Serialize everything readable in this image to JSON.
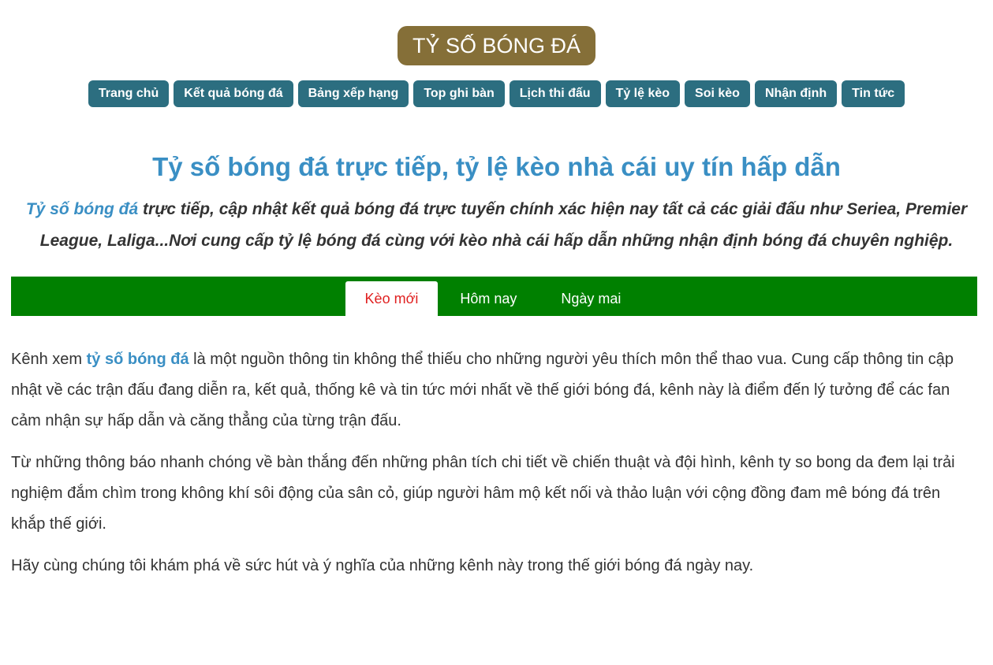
{
  "header": {
    "logo_text": "TỶ SỐ BÓNG ĐÁ"
  },
  "nav": {
    "items": [
      {
        "label": "Trang chủ"
      },
      {
        "label": "Kết quả bóng đá"
      },
      {
        "label": "Bảng xếp hạng"
      },
      {
        "label": "Top ghi bàn"
      },
      {
        "label": "Lịch thi đấu"
      },
      {
        "label": "Tỷ lệ kèo"
      },
      {
        "label": "Soi kèo"
      },
      {
        "label": "Nhận định"
      },
      {
        "label": "Tin tức"
      }
    ]
  },
  "hero": {
    "title": "Tỷ số bóng đá trực tiếp, tỷ lệ kèo nhà cái uy tín hấp dẫn",
    "intro_link": "Tỷ số bóng đá",
    "intro_text": " trực tiếp, cập nhật kết quả bóng đá trực tuyến chính xác hiện nay tất cả các giải đấu như Seriea, Premier League, Laliga...Nơi cung cấp tỷ lệ bóng đá cùng với kèo nhà cái hấp dẫn những nhận định bóng đá chuyên nghiệp."
  },
  "tabs": [
    {
      "label": "Kèo mới",
      "active": true
    },
    {
      "label": "Hôm nay",
      "active": false
    },
    {
      "label": "Ngày mai",
      "active": false
    }
  ],
  "content": {
    "p1_before": "Kênh xem ",
    "p1_link": "tỷ số bóng đá",
    "p1_after": " là một nguồn thông tin không thể thiếu cho những người yêu thích môn thể thao vua. Cung cấp thông tin cập nhật về các trận đấu đang diễn ra, kết quả, thống kê và tin tức mới nhất về thế giới bóng đá, kênh này là điểm đến lý tưởng để các fan cảm nhận sự hấp dẫn và căng thẳng của từng trận đấu.",
    "p2": "Từ những thông báo nhanh chóng về bàn thắng đến những phân tích chi tiết về chiến thuật và đội hình, kênh ty so bong da đem lại trải nghiệm đắm chìm trong không khí sôi động của sân cỏ, giúp người hâm mộ kết nối và thảo luận với cộng đồng đam mê bóng đá trên khắp thế giới.",
    "p3": "Hãy cùng chúng tôi khám phá về sức hút và ý nghĩa của những kênh này trong thế giới bóng đá ngày nay."
  },
  "colors": {
    "logo_bg": "#856f38",
    "nav_bg": "#2c6e80",
    "title_blue": "#3a8fc4",
    "tabbar_green": "#008000",
    "active_tab_text": "#e02020"
  }
}
